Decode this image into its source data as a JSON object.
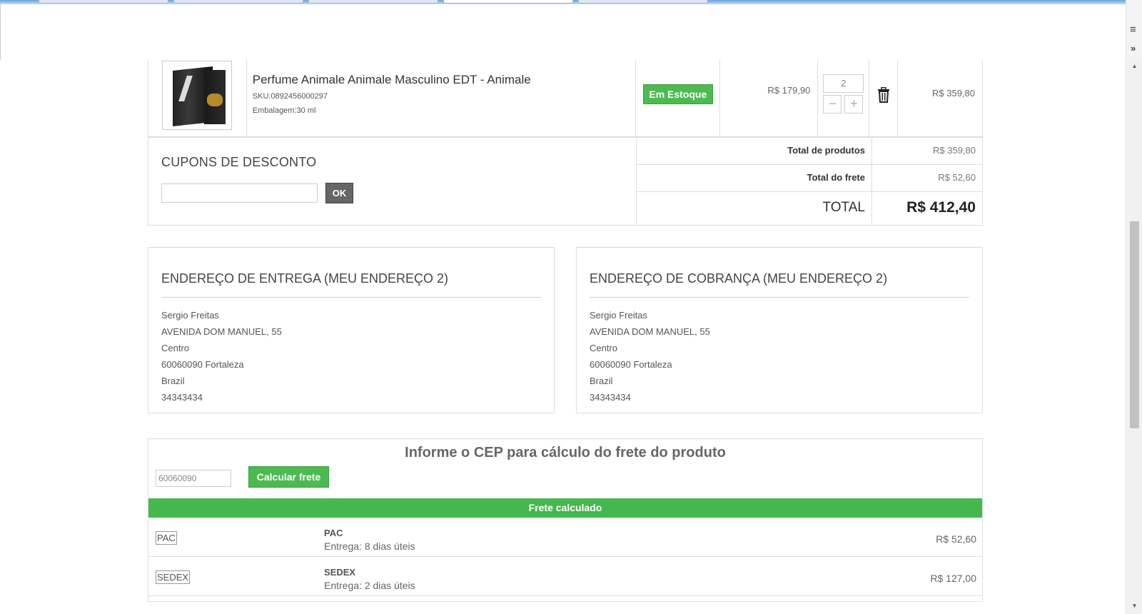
{
  "product": {
    "name": "Perfume Animale Animale Masculino EDT - Animale",
    "sku": "SKU:0892456000297",
    "packaging": "Embalagem:30 ml",
    "stock_status": "Em Estoque",
    "unit_price": "R$ 179,90",
    "quantity": "2",
    "subtotal": "R$ 359,80"
  },
  "coupon": {
    "title": "CUPONS DE DESCONTO",
    "input_value": "",
    "ok_label": "OK"
  },
  "totals": {
    "products_label": "Total de produtos",
    "products_value": "R$ 359,80",
    "shipping_label": "Total do frete",
    "shipping_value": "R$ 52,60",
    "total_label": "TOTAL",
    "total_value": "R$ 412,40"
  },
  "delivery_address": {
    "title": "ENDEREÇO DE ENTREGA (MEU ENDEREÇO 2)",
    "lines": [
      "Sergio Freitas",
      "AVENIDA DOM MANUEL, 55",
      "Centro",
      "60060090 Fortaleza",
      "Brazil",
      "34343434"
    ]
  },
  "billing_address": {
    "title": "ENDEREÇO DE COBRANÇA (MEU ENDEREÇO 2)",
    "lines": [
      "Sergio Freitas",
      "AVENIDA DOM MANUEL, 55",
      "Centro",
      "60060090 Fortaleza",
      "Brazil",
      "34343434"
    ]
  },
  "shipping": {
    "title": "Informe o CEP para cálculo do frete do produto",
    "cep_value": "60060090",
    "calc_label": "Calcular frete",
    "result_label": "Frete calculado",
    "options": [
      {
        "tag": "PAC",
        "name": "PAC",
        "eta": "Entrega: 8 dias úteis",
        "price": "R$ 52,60"
      },
      {
        "tag": "SEDEX",
        "name": "SEDEX",
        "eta": "Entrega: 2 dias úteis",
        "price": "R$ 127,00"
      }
    ]
  },
  "colors": {
    "green": "#4cba50",
    "dark_button": "#666666"
  },
  "icons": [
    "trash-icon",
    "minus-icon",
    "plus-icon",
    "menu-icon",
    "chevron-double-right-icon"
  ]
}
